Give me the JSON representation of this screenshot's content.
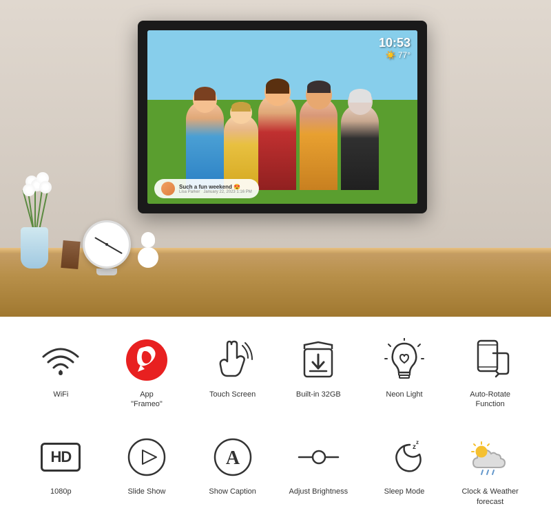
{
  "hero": {
    "time": "10:53",
    "temp": "77°",
    "caption_main": "Such a fun weekend 😍",
    "caption_author": "Lisa Parker",
    "caption_date": "January 22, 2023 1:16 PM"
  },
  "features_row1": [
    {
      "id": "wifi",
      "label": "WiFi",
      "icon": "wifi"
    },
    {
      "id": "app-frameo",
      "label": "App\n\"Frameo\"",
      "icon": "frameo"
    },
    {
      "id": "touch-screen",
      "label": "Touch Screen",
      "icon": "touch"
    },
    {
      "id": "built-in-32gb",
      "label": "Built-in 32GB",
      "icon": "storage"
    },
    {
      "id": "neon-light",
      "label": "Neon Light",
      "icon": "neon"
    },
    {
      "id": "auto-rotate",
      "label": "Auto-Rotate\nFunction",
      "icon": "rotate"
    }
  ],
  "features_row2": [
    {
      "id": "hd-1080p",
      "label": "1080p",
      "icon": "hd"
    },
    {
      "id": "slide-show",
      "label": "Slide Show",
      "icon": "play"
    },
    {
      "id": "show-caption",
      "label": "Show Caption",
      "icon": "caption"
    },
    {
      "id": "adjust-brightness",
      "label": "Adjust Brightness",
      "icon": "brightness"
    },
    {
      "id": "sleep-mode",
      "label": "Sleep Mode",
      "icon": "sleep"
    },
    {
      "id": "clock-weather",
      "label": "Clock & Weather\nforecast",
      "icon": "weather"
    }
  ]
}
